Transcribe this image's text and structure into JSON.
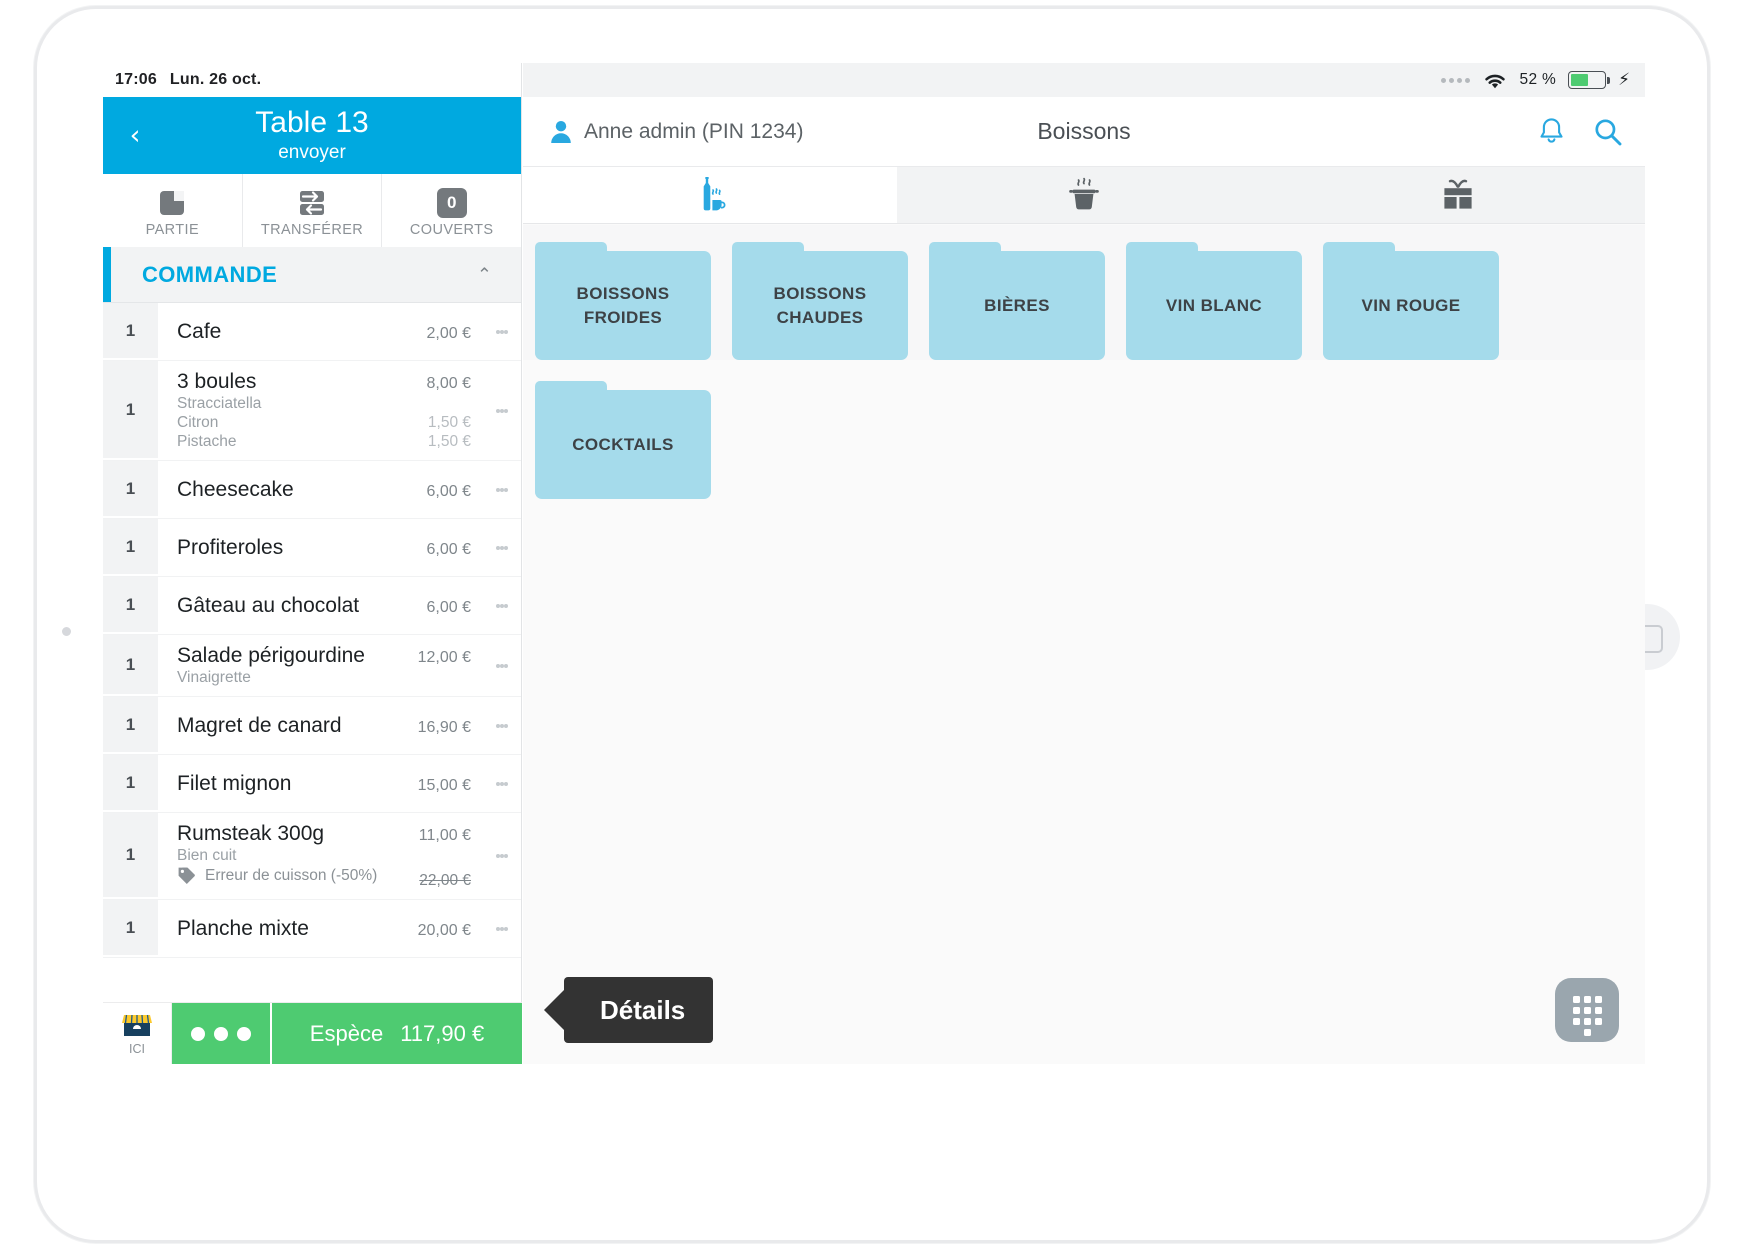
{
  "status_bar_left": {
    "time": "17:06",
    "date": "Lun. 26 oct."
  },
  "status_bar_right": {
    "battery_percent": "52 %",
    "battery_level": 52,
    "charging_glyph": "⚡"
  },
  "table_header": {
    "title": "Table 13",
    "subtitle": "envoyer",
    "back_glyph": "‹"
  },
  "actions": [
    {
      "label": "PARTIE",
      "icon": "split-check-icon",
      "badge": ""
    },
    {
      "label": "TRANSFÉRER",
      "icon": "transfer-arrows-icon",
      "badge": ""
    },
    {
      "label": "COUVERTS",
      "icon": "covers-count-icon",
      "badge": "0"
    }
  ],
  "order_section": {
    "label": "COMMANDE",
    "collapse_glyph": "⌃"
  },
  "order_items": [
    {
      "qty": "1",
      "name": "Cafe",
      "price": "2,00 €",
      "options": []
    },
    {
      "qty": "1",
      "name": "3 boules",
      "price": "8,00 €",
      "options": [
        {
          "name": "Stracciatella",
          "price": ""
        },
        {
          "name": "Citron",
          "price": "1,50 €"
        },
        {
          "name": "Pistache",
          "price": "1,50 €"
        }
      ]
    },
    {
      "qty": "1",
      "name": "Cheesecake",
      "price": "6,00 €",
      "options": []
    },
    {
      "qty": "1",
      "name": "Profiteroles",
      "price": "6,00 €",
      "options": []
    },
    {
      "qty": "1",
      "name": "Gâteau au chocolat",
      "price": "6,00 €",
      "options": []
    },
    {
      "qty": "1",
      "name": "Salade périgourdine",
      "price": "12,00 €",
      "options": [
        {
          "name": "Vinaigrette",
          "price": ""
        }
      ]
    },
    {
      "qty": "1",
      "name": "Magret de canard",
      "price": "16,90 €",
      "options": []
    },
    {
      "qty": "1",
      "name": "Filet mignon",
      "price": "15,00 €",
      "options": []
    },
    {
      "qty": "1",
      "name": "Rumsteak 300g",
      "price": "11,00 €",
      "options": [
        {
          "name": "Bien cuit",
          "price": ""
        }
      ],
      "discount": {
        "label": "Erreur de cuisson (-50%)",
        "old_price": "22,00 €"
      }
    },
    {
      "qty": "1",
      "name": "Planche mixte",
      "price": "20,00 €",
      "options": []
    }
  ],
  "pay_bar": {
    "place_label": "ICI",
    "more_label": "more-options",
    "payment_method": "Espèce",
    "total": "117,90 €"
  },
  "tooltip": {
    "label": "Détails"
  },
  "right_header": {
    "user": "Anne admin (PIN 1234)",
    "title": "Boissons",
    "bell_icon": "bell-icon",
    "search_icon": "search-icon"
  },
  "category_tabs": [
    {
      "icon": "drinks-icon",
      "active": true
    },
    {
      "icon": "food-pot-icon",
      "active": false
    },
    {
      "icon": "gift-icon",
      "active": false
    }
  ],
  "folders": [
    {
      "name": "BOISSONS FROIDES"
    },
    {
      "name": "BOISSONS CHAUDES"
    },
    {
      "name": "BIÈRES"
    },
    {
      "name": "VIN BLANC"
    },
    {
      "name": "VIN ROUGE"
    },
    {
      "name": "COCKTAILS"
    }
  ],
  "numpad_fab": {
    "icon": "numpad-icon"
  },
  "colors": {
    "accent_blue": "#00a9e0",
    "folder_blue": "#a5dbeb",
    "green": "#4ecb71",
    "tooltip_dark": "#333333"
  }
}
